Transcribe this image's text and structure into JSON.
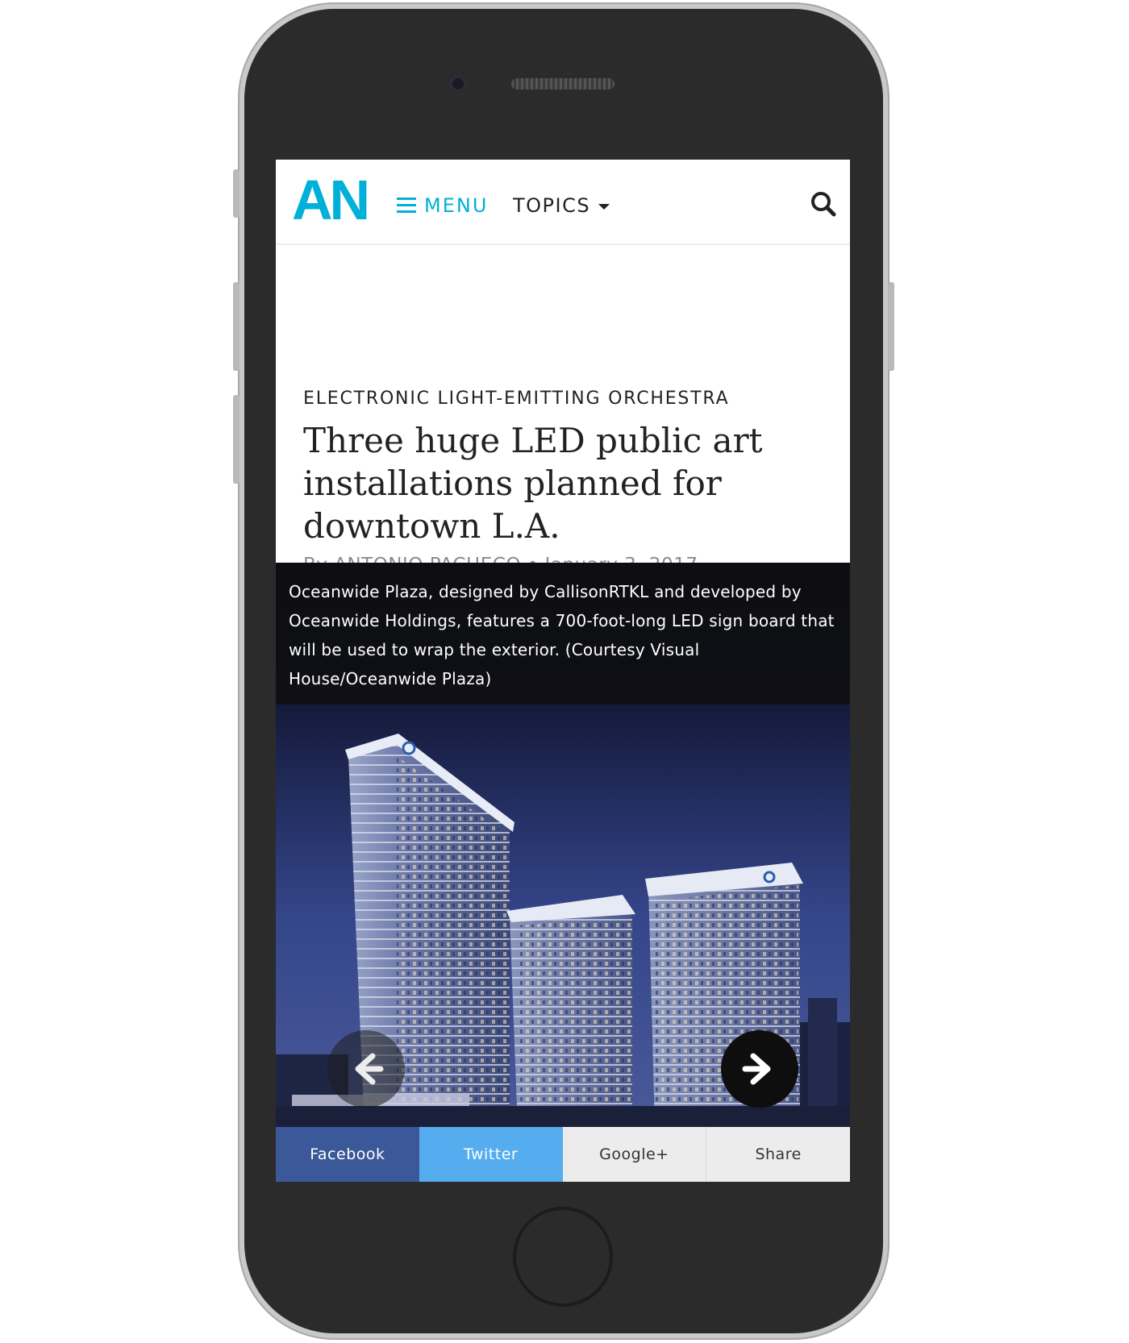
{
  "header": {
    "logo_text": "AN",
    "menu_label": "MENU",
    "topics_label": "TOPICS"
  },
  "article": {
    "kicker": "ELECTRONIC LIGHT-EMITTING ORCHESTRA",
    "title": "Three huge LED public art installations planned for downtown L.A.",
    "byline": "By ANTONIO PACHECO • January 3, 2017"
  },
  "gallery": {
    "caption": "Oceanwide Plaza, designed by CallisonRTKL and developed by Oceanwide Holdings, features a 700-foot-long LED sign board that will be used to wrap the exterior. (Courtesy Visual House/Oceanwide Plaza)"
  },
  "share": {
    "facebook": "Facebook",
    "twitter": "Twitter",
    "google": "Google+",
    "share": "Share"
  },
  "colors": {
    "brand": "#00b0d8",
    "facebook": "#3b5998",
    "twitter": "#55acee"
  },
  "icons": [
    "hamburger-icon",
    "chevron-down-icon",
    "search-icon",
    "arrow-left-icon",
    "arrow-right-icon"
  ]
}
